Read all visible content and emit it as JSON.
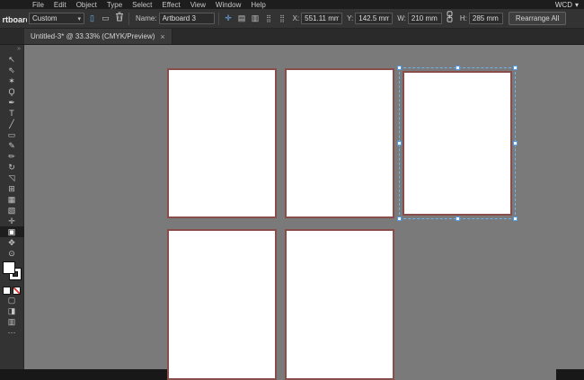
{
  "menubar": {
    "items": [
      "File",
      "Edit",
      "Object",
      "Type",
      "Select",
      "Effect",
      "View",
      "Window",
      "Help"
    ],
    "right_label": "WCD"
  },
  "controlbar": {
    "panel_label": "Artboard",
    "preset_value": "Custom",
    "name_label": "Name:",
    "name_value": "Artboard 3",
    "x_label": "X:",
    "x_value": "551.11 mm",
    "y_label": "Y:",
    "y_value": "142.5 mm",
    "w_label": "W:",
    "w_value": "210 mm",
    "h_label": "H:",
    "h_value": "285 mm",
    "rearrange_label": "Rearrange All"
  },
  "tabbar": {
    "tab_title": "Untitled-3* @ 33.33% (CMYK/Preview)",
    "close_glyph": "×"
  },
  "toolbar": {
    "collapse_glyph": "»",
    "tools": [
      {
        "name": "selection-tool",
        "glyph": "↖"
      },
      {
        "name": "direct-selection-tool",
        "glyph": "⇖"
      },
      {
        "name": "magic-wand-tool",
        "glyph": "✶"
      },
      {
        "name": "lasso-tool",
        "glyph": "Ϙ"
      },
      {
        "name": "pen-tool",
        "glyph": "✒"
      },
      {
        "name": "type-tool",
        "glyph": "T"
      },
      {
        "name": "line-segment-tool",
        "glyph": "╱"
      },
      {
        "name": "rectangle-tool",
        "glyph": "▭"
      },
      {
        "name": "paintbrush-tool",
        "glyph": "✎"
      },
      {
        "name": "pencil-tool",
        "glyph": "✏"
      },
      {
        "name": "rotate-tool",
        "glyph": "↻"
      },
      {
        "name": "scale-tool",
        "glyph": "◹"
      },
      {
        "name": "shape-builder-tool",
        "glyph": "⊞"
      },
      {
        "name": "mesh-tool",
        "glyph": "▦"
      },
      {
        "name": "gradient-tool",
        "glyph": "▧"
      },
      {
        "name": "eyedropper-tool",
        "glyph": "✛"
      },
      {
        "name": "artboard-tool",
        "glyph": "▣",
        "active": true
      },
      {
        "name": "hand-tool",
        "glyph": "✥"
      },
      {
        "name": "zoom-tool",
        "glyph": "⊙"
      }
    ],
    "bottom_icons": [
      {
        "name": "draw-normal-mode-icon",
        "glyph": "▢"
      },
      {
        "name": "draw-behind-mode-icon",
        "glyph": "◨"
      },
      {
        "name": "screen-mode-icon",
        "glyph": "▥"
      },
      {
        "name": "edit-toolbar-icon",
        "glyph": "⋯"
      }
    ]
  },
  "icons": {
    "chevron_down": "▾",
    "portrait": "▯",
    "landscape": "▭",
    "move_artwork": "✛",
    "artboard_options": "▤",
    "artboard_presets": "▥",
    "reference_grid": "⣿"
  },
  "canvas": {
    "artboards": [
      {
        "id": 1,
        "selected": false
      },
      {
        "id": 2,
        "selected": false
      },
      {
        "id": 3,
        "selected": true
      },
      {
        "id": 4,
        "selected": false
      },
      {
        "id": 5,
        "selected": false
      }
    ]
  },
  "colors": {
    "canvas_bg": "#7a7a7a",
    "panel_bg": "#333333",
    "dark_bg": "#1d1d1d",
    "tabbar_bg": "#2a2a2a",
    "tab_bg": "#3a3a3a",
    "toolbar_bg": "#333333",
    "field_bg": "#2b2b2b",
    "field_border": "#5a5a5a",
    "artboard_border": "#8a4e4a",
    "selection": "#6fb3f0",
    "accent": "#6fb3f0",
    "strip": "#181818"
  }
}
